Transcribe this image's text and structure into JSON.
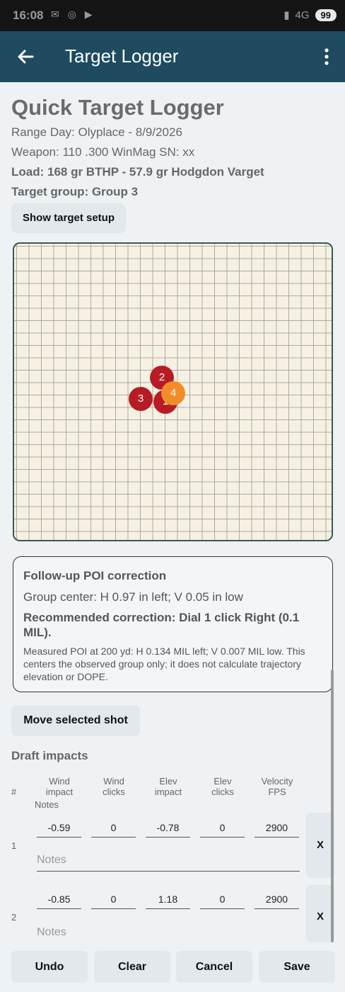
{
  "status_bar": {
    "time": "16:08",
    "left_icons": "✉ ◎ ▶",
    "network": "4G",
    "battery": "99"
  },
  "app_bar": {
    "title": "Target Logger",
    "back_icon": "arrow-left-icon",
    "menu_icon": "more-vert-icon"
  },
  "header": {
    "title": "Quick Target Logger",
    "range_day": "Range Day: Olyplace - 8/9/2026",
    "weapon": "Weapon: 110  .300 WinMag  SN: xx",
    "load": "Load: 168 gr BTHP - 57.9 gr Hodgdon Varget",
    "target_group": "Target group: Group 3"
  },
  "buttons": {
    "show_target_setup": "Show target setup",
    "move_selected_shot": "Move selected shot"
  },
  "target": {
    "shots": [
      {
        "label": "2",
        "color": "#b71c24"
      },
      {
        "label": "3",
        "color": "#b71c24"
      },
      {
        "label": "1",
        "color": "#b71c24"
      },
      {
        "label": "4",
        "color": "#f28c28"
      }
    ]
  },
  "poi": {
    "heading": "Follow-up POI correction",
    "group_center": "Group center: H 0.97 in left; V 0.05 in low",
    "recommended": "Recommended correction: Dial 1 click Right (0.1 MIL).",
    "note": "Measured POI at 200 yd: H 0.134 MIL left; V 0.007 MIL low. This centers the observed group only; it does not calculate trajectory elevation or DOPE."
  },
  "draft": {
    "title": "Draft impacts",
    "columns": {
      "num": "#",
      "wind_impact": "Wind impact",
      "wind_clicks": "Wind clicks",
      "elev_impact": "Elev impact",
      "elev_clicks": "Elev clicks",
      "velocity": "Velocity FPS",
      "notes": "Notes"
    },
    "rows": [
      {
        "num": "1",
        "wind_impact": "-0.59",
        "wind_clicks": "0",
        "elev_impact": "-0.78",
        "elev_clicks": "0",
        "velocity": "2900",
        "notes_placeholder": "Notes",
        "delete": "X"
      },
      {
        "num": "2",
        "wind_impact": "-0.85",
        "wind_clicks": "0",
        "elev_impact": "1.18",
        "elev_clicks": "0",
        "velocity": "2900",
        "notes_placeholder": "Notes",
        "delete": "X"
      }
    ]
  },
  "bottom_bar": {
    "undo": "Undo",
    "clear": "Clear",
    "cancel": "Cancel",
    "save": "Save"
  }
}
